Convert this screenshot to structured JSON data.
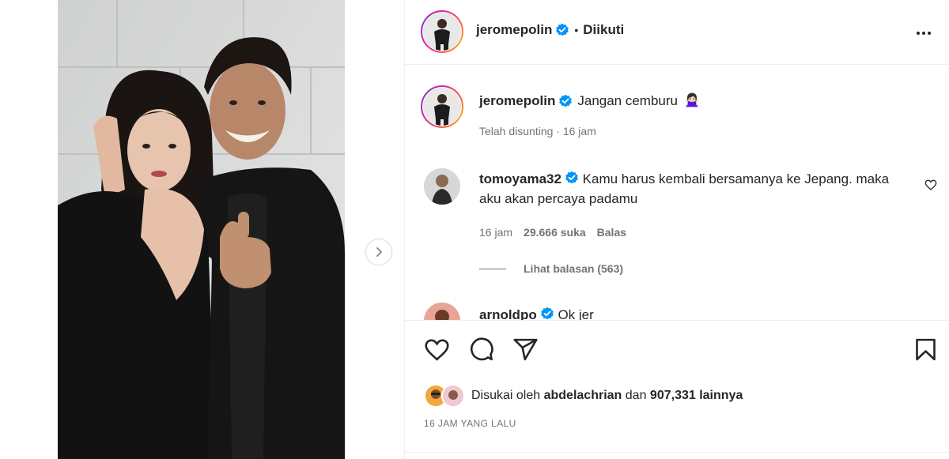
{
  "post": {
    "author": {
      "username": "jeromepolin",
      "verified": true,
      "follow_status": "Diikuti"
    },
    "caption": {
      "username": "jeromepolin",
      "text": "Jangan cemburu",
      "emoji": "🙅🏻‍♀️",
      "edited_time": "Telah disunting · 16 jam"
    },
    "comments": [
      {
        "username": "tomoyama32",
        "verified": true,
        "text": "Kamu harus kembali bersamanya ke Jepang. maka aku akan percaya padamu",
        "time": "16 jam",
        "likes": "29.666 suka",
        "reply_label": "Balas",
        "view_replies": "Lihat balasan (563)"
      },
      {
        "username": "arnoldpo",
        "verified": true,
        "text": "Ok jer"
      }
    ],
    "likes_summary": {
      "prefix": "Disukai oleh",
      "first_user": "abdelachrian",
      "connector": "dan",
      "count": "907,331 lainnya"
    },
    "time_ago": "16 JAM YANG LALU",
    "icons": {
      "more": "more-options-icon",
      "like": "heart-icon",
      "comment": "comment-icon",
      "share": "share-icon",
      "save": "bookmark-icon",
      "next": "chevron-right-icon",
      "verified": "verified-badge-icon"
    },
    "colors": {
      "verified": "#0095f6",
      "text": "#262626",
      "secondary": "#737373",
      "border": "#efefef"
    }
  }
}
